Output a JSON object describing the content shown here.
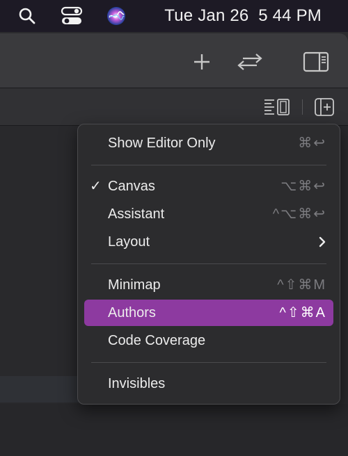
{
  "menubar": {
    "search_icon": "search-icon",
    "control_center_icon": "control-center-icon",
    "siri_icon": "siri-icon",
    "clock": "Tue Jan 26  5 44 PM"
  },
  "toolbar": {
    "add_icon": "plus-icon",
    "swap_icon": "swap-arrows-icon",
    "inspector_icon": "inspector-toggle-icon"
  },
  "tabbar": {
    "editor_options_icon": "editor-options-icon",
    "add_editor_icon": "add-editor-icon"
  },
  "menu": {
    "items": [
      {
        "label": "Show Editor Only",
        "shortcut": "⌘↩",
        "checked": false,
        "highlighted": false
      },
      {
        "label": "Canvas",
        "shortcut": "⌥⌘↩",
        "checked": true,
        "highlighted": false
      },
      {
        "label": "Assistant",
        "shortcut": "^⌥⌘↩",
        "checked": false,
        "highlighted": false
      },
      {
        "label": "Layout",
        "shortcut": "",
        "submenu": true,
        "checked": false,
        "highlighted": false
      },
      {
        "label": "Minimap",
        "shortcut": "^⇧⌘M",
        "checked": false,
        "highlighted": false
      },
      {
        "label": "Authors",
        "shortcut": "^⇧⌘A",
        "checked": false,
        "highlighted": true
      },
      {
        "label": "Code Coverage",
        "shortcut": "",
        "checked": false,
        "highlighted": false
      },
      {
        "label": "Invisibles",
        "shortcut": "",
        "checked": false,
        "highlighted": false
      }
    ],
    "checkmark": "✓",
    "highlight_color": "#8d3aa0"
  }
}
